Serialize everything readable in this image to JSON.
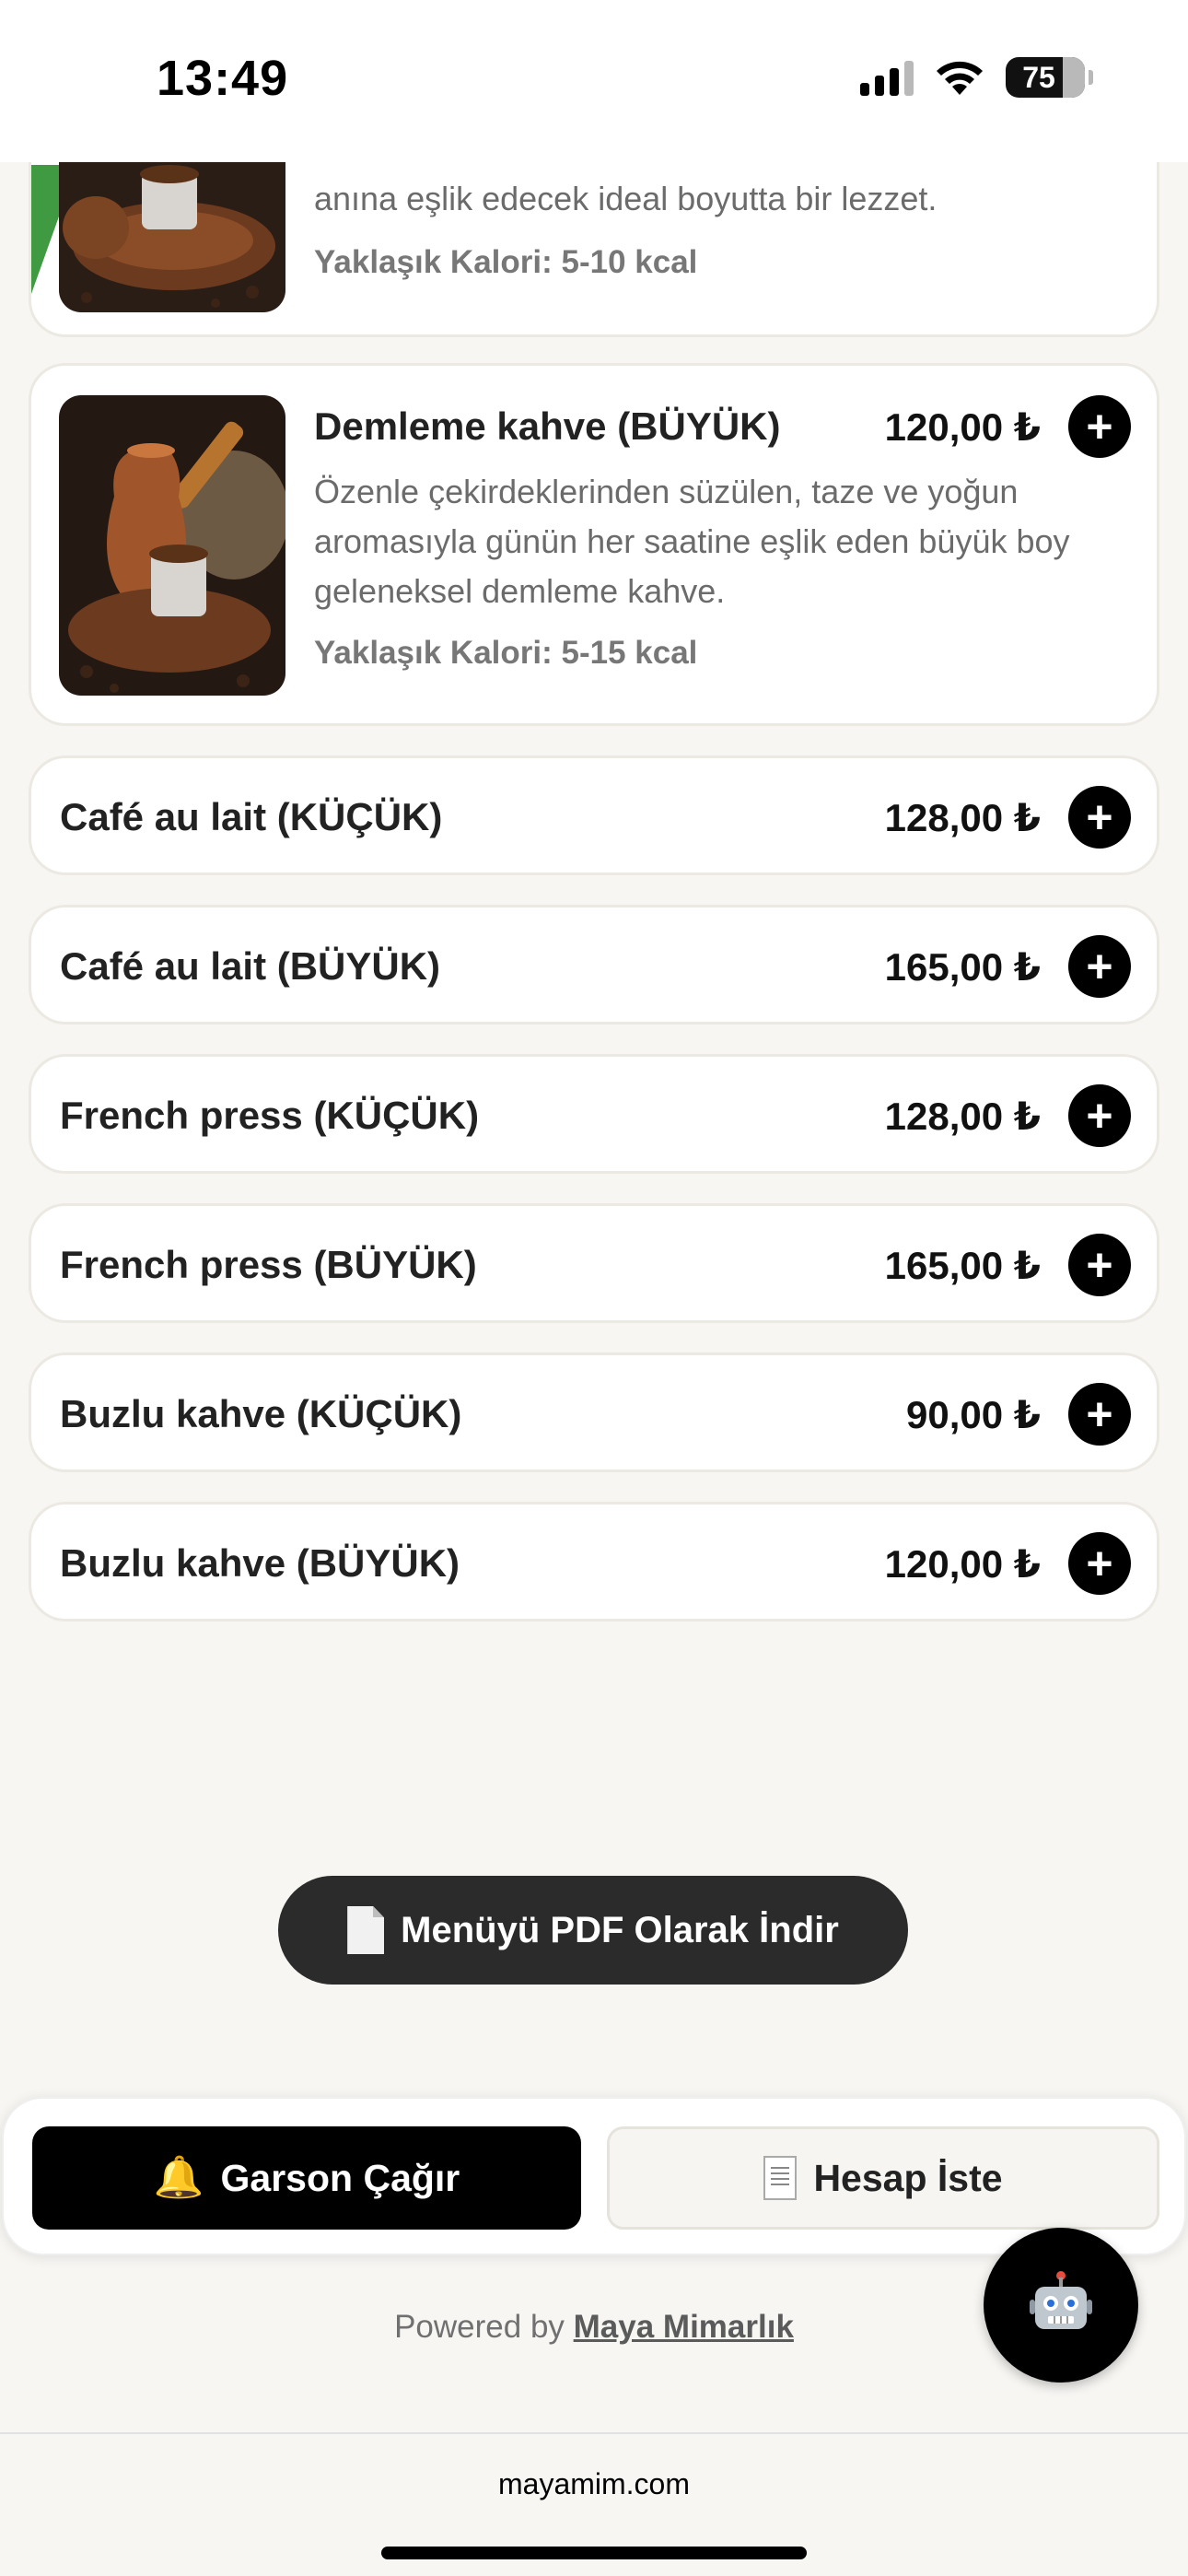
{
  "status_bar": {
    "time": "13:49",
    "battery": "75"
  },
  "menu": {
    "items_detailed": [
      {
        "desc": "anına eşlik edecek ideal boyutta bir lezzet.",
        "calories": "Yaklaşık Kalori: 5-10 kcal"
      },
      {
        "title": "Demleme kahve (BÜYÜK)",
        "price": "120,00 ₺",
        "desc": "Özenle çekirdeklerinden süzülen, taze ve yoğun aromasıyla günün her saatine eşlik eden büyük boy geleneksel demleme kahve.",
        "calories": "Yaklaşık Kalori: 5-15 kcal"
      }
    ],
    "items": [
      {
        "title": "Café au lait (KÜÇÜK)",
        "price": "128,00 ₺"
      },
      {
        "title": "Café au lait (BÜYÜK)",
        "price": "165,00 ₺"
      },
      {
        "title": "French press (KÜÇÜK)",
        "price": "128,00 ₺"
      },
      {
        "title": "French press (BÜYÜK)",
        "price": "165,00 ₺"
      },
      {
        "title": "Buzlu kahve (KÜÇÜK)",
        "price": "90,00 ₺"
      },
      {
        "title": "Buzlu kahve (BÜYÜK)",
        "price": "120,00 ₺"
      }
    ],
    "add_symbol": "+"
  },
  "pdf_button": {
    "label": "Menüyü PDF Olarak İndir",
    "icon": "document-icon"
  },
  "bottom_bar": {
    "waiter": {
      "label": "Garson Çağır",
      "icon": "bell-icon"
    },
    "bill": {
      "label": "Hesap İste",
      "icon": "receipt-icon"
    }
  },
  "footer": {
    "powered_prefix": "Powered by",
    "powered_link": "Maya Mimarlık"
  },
  "browser": {
    "url": "mayamim.com"
  },
  "colors": {
    "accent_green": "#3f9a41",
    "button_dark": "#000000",
    "pdf_bg": "#2b2b2b"
  }
}
